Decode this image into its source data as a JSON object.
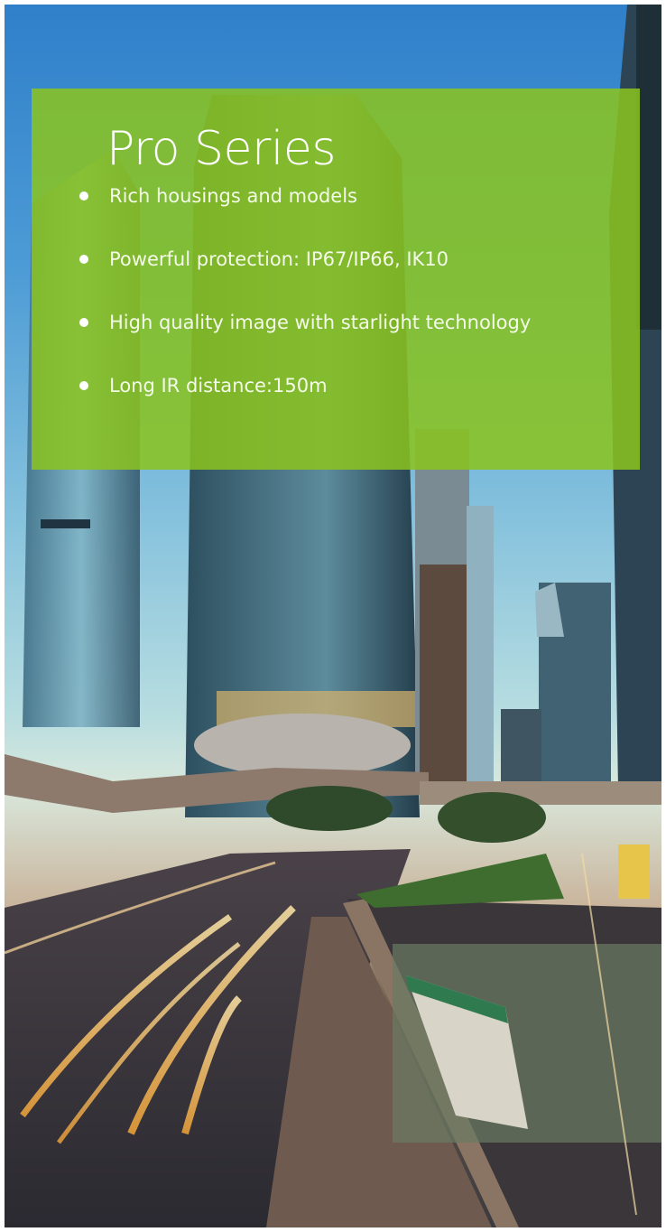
{
  "panel": {
    "title": "Pro Series",
    "features": [
      "Rich housings and models",
      "Powerful protection: IP67/IP66, IK10",
      "High quality image with starlight technology",
      "Long IR distance:150m"
    ],
    "background_color": "#8bc41e"
  }
}
